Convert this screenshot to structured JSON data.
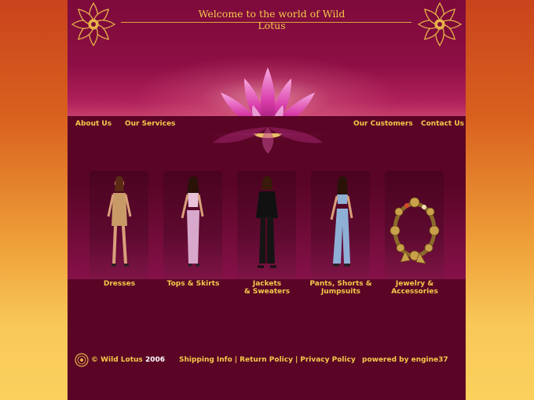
{
  "header": {
    "welcome": "Welcome to the world of Wild Lotus"
  },
  "nav": {
    "about": "About Us",
    "services": "Our Services",
    "customers": "Our Customers",
    "contact": "Contact Us"
  },
  "categories": [
    {
      "line1": "Dresses",
      "line2": ""
    },
    {
      "line1": "Tops & Skirts",
      "line2": ""
    },
    {
      "line1": "Jackets",
      "line2": "& Sweaters"
    },
    {
      "line1": "Pants, Shorts &",
      "line2": "Jumpsuits"
    },
    {
      "line1": "Jewelry &",
      "line2": "Accessories"
    }
  ],
  "footer": {
    "copyright_name": "© Wild Lotus",
    "copyright_year": "2006",
    "links": [
      "Shipping Info",
      "Return Policy",
      "Privacy Policy"
    ],
    "separator": "|",
    "powered": "powered by engine37"
  },
  "colors": {
    "gold": "#f5c94a",
    "maroon": "#5a0526",
    "magenta": "#8e0f45"
  }
}
